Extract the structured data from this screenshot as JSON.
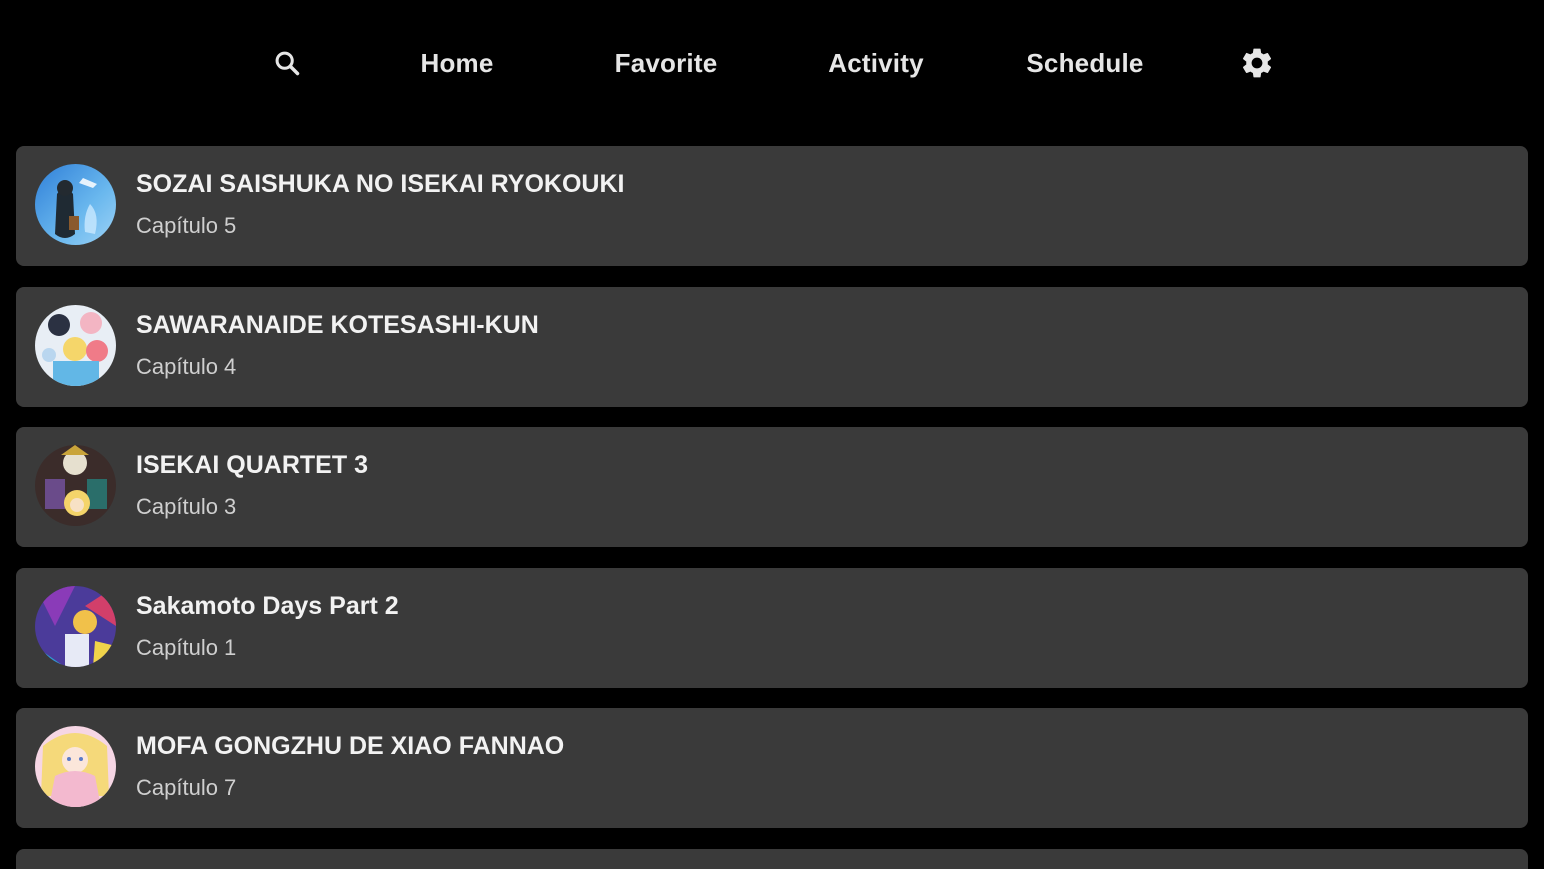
{
  "nav": {
    "search_icon": "search-icon",
    "home_label": "Home",
    "favorite_label": "Favorite",
    "activity_label": "Activity",
    "schedule_label": "Schedule",
    "settings_icon": "gear-icon"
  },
  "items": [
    {
      "title": "SOZAI SAISHUKA NO ISEKAI RYOKOUKI",
      "subtitle": "Capítulo 5"
    },
    {
      "title": "SAWARANAIDE KOTESASHI-KUN",
      "subtitle": "Capítulo 4"
    },
    {
      "title": "ISEKAI QUARTET 3",
      "subtitle": "Capítulo 3"
    },
    {
      "title": "Sakamoto Days Part 2",
      "subtitle": "Capítulo 1"
    },
    {
      "title": "MOFA GONGZHU DE XIAO FANNAO",
      "subtitle": "Capítulo 7"
    }
  ],
  "colors": {
    "background": "#000000",
    "card": "#3a3a3a",
    "text_primary": "#f2f2f2",
    "text_secondary": "#cfcfcf"
  }
}
